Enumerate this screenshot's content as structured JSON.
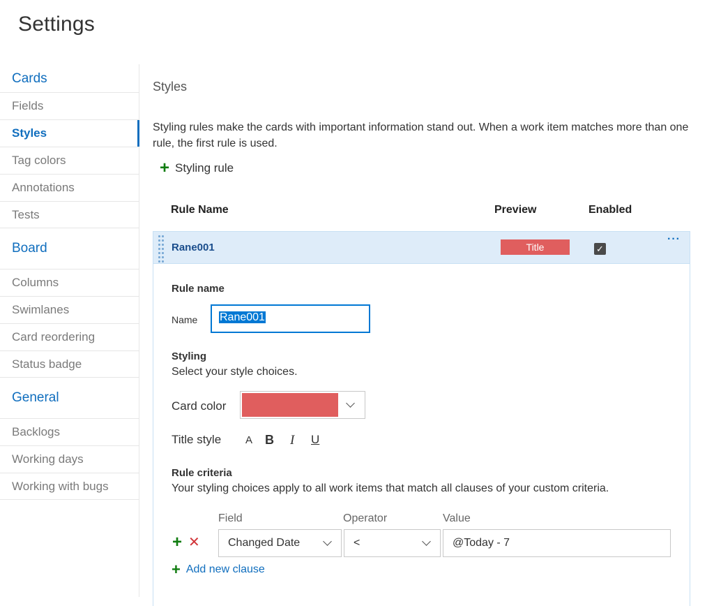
{
  "page_title": "Settings",
  "sidebar": {
    "groups": [
      {
        "title": "Cards",
        "items": [
          "Fields",
          "Styles",
          "Tag colors",
          "Annotations",
          "Tests"
        ]
      },
      {
        "title": "Board",
        "items": [
          "Columns",
          "Swimlanes",
          "Card reordering",
          "Status badge"
        ]
      },
      {
        "title": "General",
        "items": [
          "Backlogs",
          "Working days",
          "Working with bugs"
        ]
      }
    ],
    "selected": "Styles"
  },
  "main": {
    "section_title": "Styles",
    "description": "Styling rules make the cards with important information stand out. When a work item matches more than one rule, the first rule is used.",
    "add_rule_label": "Styling rule",
    "columns": {
      "rule_name": "Rule Name",
      "preview": "Preview",
      "enabled": "Enabled"
    },
    "rule": {
      "name": "Rane001",
      "preview_text": "Title",
      "enabled": true,
      "more": "···"
    },
    "editor": {
      "rule_name_header": "Rule name",
      "name_label": "Name",
      "name_value": "Rane001",
      "styling_header": "Styling",
      "styling_sub": "Select your style choices.",
      "card_color_label": "Card color",
      "card_color": "#e05e5e",
      "title_style_label": "Title style",
      "title_style_options": [
        "A",
        "B",
        "I",
        "U"
      ],
      "criteria_header": "Rule criteria",
      "criteria_sub": "Your styling choices apply to all work items that match all clauses of your custom criteria.",
      "clause_headers": {
        "field": "Field",
        "operator": "Operator",
        "value": "Value"
      },
      "clause": {
        "field": "Changed Date",
        "operator": "<",
        "value": "@Today - 7"
      },
      "add_clause_label": "Add new clause"
    }
  },
  "colors": {
    "accent": "#106ebe",
    "selected_row": "#deecf9",
    "add_green": "#107c10",
    "delete_red": "#d13438"
  }
}
